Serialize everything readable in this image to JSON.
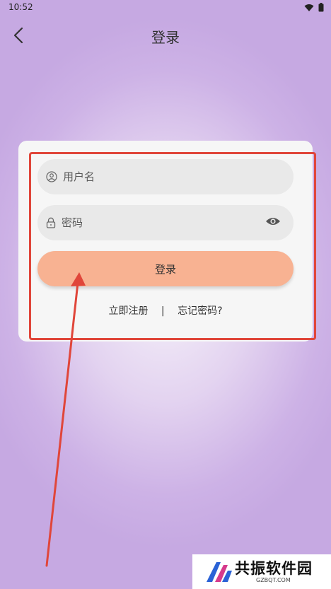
{
  "status_bar": {
    "time": "10:52"
  },
  "header": {
    "title": "登录"
  },
  "login_form": {
    "username_placeholder": "用户名",
    "password_placeholder": "密码",
    "submit_label": "登录",
    "register_link": "立即注册",
    "separator": "|",
    "forgot_link": "忘记密码?"
  },
  "icons": {
    "back": "chevron-left-icon",
    "user": "user-circle-icon",
    "lock": "lock-icon",
    "eye": "eye-icon"
  },
  "colors": {
    "login_button": "#f8b292",
    "highlight_annotation": "#e0463a",
    "background_purple": "#c6a9e2"
  },
  "watermark": {
    "brand": "共振软件园",
    "domain": "GZBQT.COM"
  }
}
